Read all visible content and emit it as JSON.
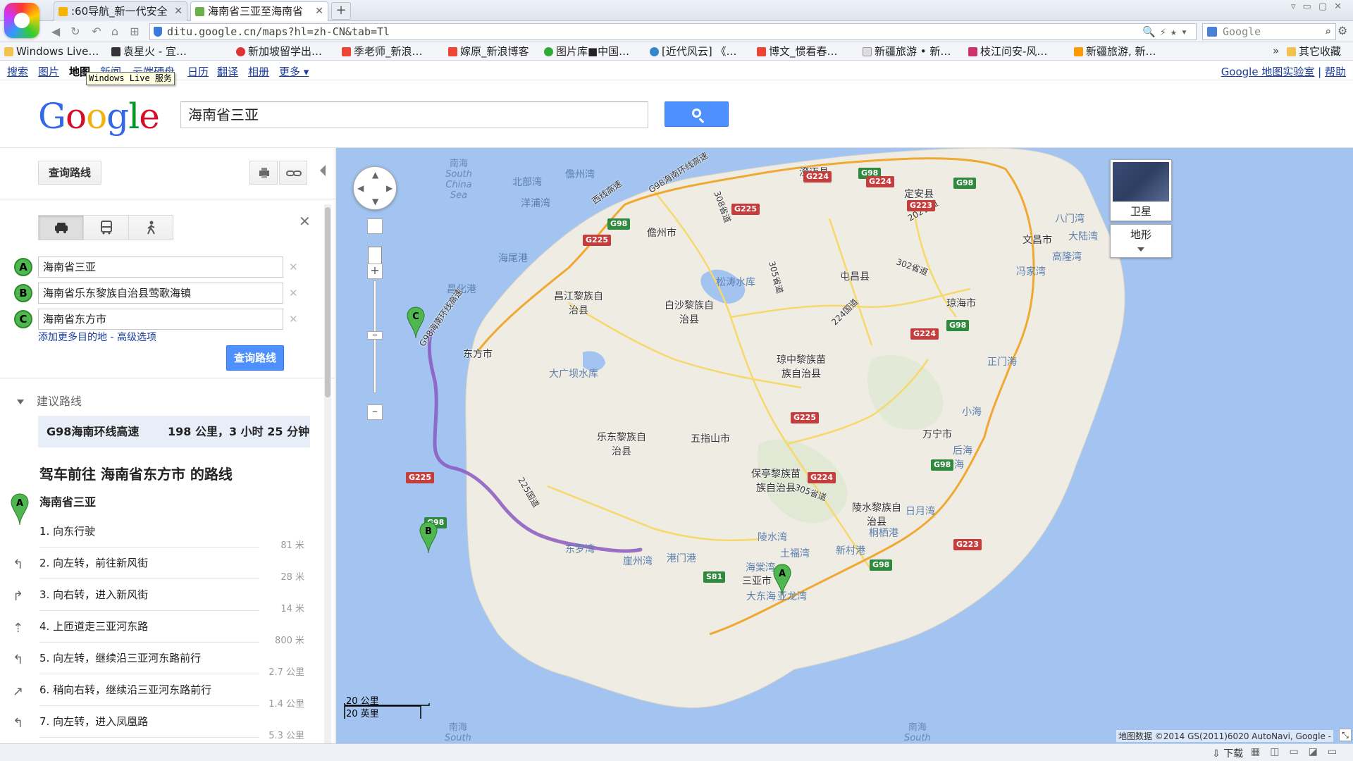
{
  "browser": {
    "tabs": [
      {
        "label": ":60导航_新一代安全",
        "active": false
      },
      {
        "label": "海南省三亚至海南省",
        "active": true
      }
    ],
    "url": "ditu.google.cn/maps?hl=zh-CN&tab=Tl",
    "search_placeholder": "Google",
    "bookmarks": [
      "Windows Live…",
      "袁星火 - 宜…",
      "新加坡留学出…",
      "季老师_新浪…",
      "嫁原_新浪博客",
      "图片库■中国…",
      "[近代风云] 《…",
      "博文_惯看春…",
      "新疆旅游 • 新…",
      "枝江问安-风…",
      "新疆旅游, 新…"
    ],
    "bookmarks_more": "»",
    "other_bookmarks": "其它收藏",
    "status_download": "下载"
  },
  "gbar": {
    "items": [
      "搜索",
      "图片",
      "地图",
      "新闻",
      "云端硬盘",
      "日历",
      "翻译",
      "相册",
      "更多 ▾"
    ],
    "current": "地图",
    "tooltip": "Windows Live 服务",
    "right_links": [
      "Google 地图实验室",
      "帮助"
    ],
    "separator": "|"
  },
  "header": {
    "logo_letters": [
      "G",
      "o",
      "o",
      "g",
      "l",
      "e"
    ],
    "logo_colors": [
      "#3369e8",
      "#d50f25",
      "#eeb211",
      "#3369e8",
      "#009925",
      "#d50f25"
    ],
    "query": "海南省三亚"
  },
  "panel": {
    "get_directions": "查询路线",
    "waypoints": [
      {
        "marker": "A",
        "value": "海南省三亚"
      },
      {
        "marker": "B",
        "value": "海南省乐东黎族自治县莺歌海镇"
      },
      {
        "marker": "C",
        "value": "海南省东方市"
      }
    ],
    "add_destination": "添加更多目的地",
    "separator": " - ",
    "advanced_options": "高级选项",
    "submit": "查询路线",
    "suggested_header": "建议路线",
    "route": {
      "name": "G98海南环线高速",
      "summary": "198 公里，3 小时 25 分钟"
    },
    "directions_title": "驾车前往 海南省东方市 的路线",
    "start": {
      "marker": "A",
      "name": "海南省三亚"
    },
    "steps": [
      {
        "text": "1. 向东行驶",
        "distance": "81 米",
        "icon": "straight-icon"
      },
      {
        "text": "2. 向左转，前往新风街",
        "distance": "28 米",
        "icon": "turn-left-icon"
      },
      {
        "text": "3. 向右转，进入新风街",
        "distance": "14 米",
        "icon": "turn-right-icon"
      },
      {
        "text": "4. 上匝道走三亚河东路",
        "distance": "800 米",
        "icon": "ramp-icon"
      },
      {
        "text": "5. 向左转，继续沿三亚河东路前行",
        "distance": "2.7 公里",
        "icon": "turn-left-icon"
      },
      {
        "text": "6. 稍向右转，继续沿三亚河东路前行",
        "distance": "1.4 公里",
        "icon": "slight-right-icon"
      },
      {
        "text": "7. 向左转，进入凤凰路",
        "distance": "5.3 公里",
        "icon": "turn-left-icon"
      }
    ]
  },
  "map": {
    "map_type_satellite": "卫星",
    "map_type_terrain": "地形",
    "scale_metric": "20 公里",
    "scale_imperial": "20 英里",
    "copyright": "地图数据 ©2014 GS(2011)6020 AutoNavi, Google -",
    "route_markers": [
      "A",
      "B",
      "C"
    ],
    "sea_labels": [
      {
        "cn": "南海",
        "en": "South China Sea"
      },
      {
        "cn": "南海",
        "en": "South"
      },
      {
        "cn": "南海",
        "en": "South"
      }
    ],
    "places": [
      "北部湾",
      "儋州湾",
      "洋浦湾",
      "澄迈县",
      "定安县",
      "八门湾",
      "文昌市",
      "大陆湾",
      "高隆湾",
      "冯家湾",
      "儋州市",
      "海尾港",
      "昌化港",
      "昌江黎族自治县",
      "白沙黎族自治县",
      "松涛水库",
      "屯昌县",
      "琼海市",
      "东方市",
      "大广坝水库",
      "琼中黎族苗族自治县",
      "正门海",
      "小海",
      "万宁市",
      "后海",
      "老爷海",
      "乐东黎族自治县",
      "五指山市",
      "保亭黎族苗族自治县",
      "陵水黎族自治县",
      "日月湾",
      "桐栖港",
      "新村港",
      "土福湾",
      "陵水湾",
      "海棠湾",
      "东罗湾",
      "崖州湾",
      "港门港",
      "三亚市",
      "大东海",
      "亚龙湾"
    ],
    "road_labels": [
      "G98海南环线高速",
      "西线高速",
      "G98海南环线高速",
      "224国道",
      "202省道",
      "302省道",
      "305省道",
      "308省道",
      "305省道",
      "225国道"
    ],
    "shields": [
      {
        "text": "G98",
        "color": "g"
      },
      {
        "text": "G225",
        "color": "r"
      },
      {
        "text": "G224",
        "color": "r"
      },
      {
        "text": "G98",
        "color": "g"
      },
      {
        "text": "G224",
        "color": "r"
      },
      {
        "text": "G223",
        "color": "r"
      },
      {
        "text": "G225",
        "color": "r"
      },
      {
        "text": "G98",
        "color": "g"
      },
      {
        "text": "G98",
        "color": "g"
      },
      {
        "text": "G224",
        "color": "r"
      },
      {
        "text": "G98",
        "color": "g"
      },
      {
        "text": "G98",
        "color": "g"
      },
      {
        "text": "G223",
        "color": "r"
      },
      {
        "text": "S81",
        "color": "g"
      },
      {
        "text": "G224",
        "color": "r"
      },
      {
        "text": "G98",
        "color": "g"
      },
      {
        "text": "G225",
        "color": "r"
      },
      {
        "text": "G225",
        "color": "r"
      }
    ]
  }
}
